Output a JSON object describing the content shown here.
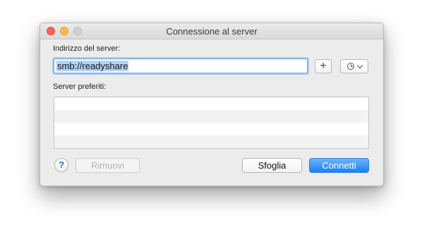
{
  "window": {
    "title": "Connessione al server"
  },
  "address": {
    "label": "Indirizzo del server:",
    "value": "smb://readyshare"
  },
  "toolbar": {
    "add_symbol": "+",
    "recent_icon": "clock-icon"
  },
  "favorites": {
    "label": "Server preferiti:",
    "items": []
  },
  "buttons": {
    "help": "?",
    "remove": "Rimuovi",
    "browse": "Sfoglia",
    "connect": "Connetti"
  },
  "colors": {
    "accent": "#1b7ff5",
    "selection": "#b2d1f6",
    "close": "#fc605b",
    "minimize": "#fdbc40"
  }
}
